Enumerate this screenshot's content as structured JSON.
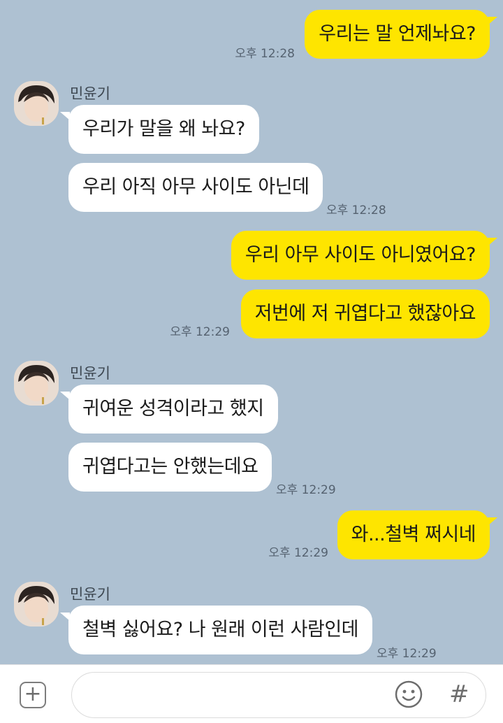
{
  "contact": {
    "name": "민윤기"
  },
  "messages": [
    {
      "side": "out",
      "text": "우리는 말 언제놔요?",
      "time": "오후 12:28"
    },
    {
      "side": "in",
      "sender": "민윤기",
      "text": "우리가 말을 왜 놔요?"
    },
    {
      "side": "in",
      "text": "우리 아직 아무 사이도 아닌데",
      "time": "오후 12:28"
    },
    {
      "side": "out",
      "text": "우리 아무 사이도 아니였어요?"
    },
    {
      "side": "out",
      "text": "저번에 저 귀엽다고 했잖아요",
      "time": "오후 12:29"
    },
    {
      "side": "in",
      "sender": "민윤기",
      "text": "귀여운 성격이라고 했지"
    },
    {
      "side": "in",
      "text": "귀엽다고는 안했는데요",
      "time": "오후 12:29"
    },
    {
      "side": "out",
      "text": "와...철벽 쩌시네",
      "time": "오후 12:29"
    },
    {
      "side": "in",
      "sender": "민윤기",
      "text": "철벽 싫어요? 나 원래 이런 사람인데",
      "time": "오후 12:29"
    }
  ],
  "composer": {
    "placeholder": "",
    "plus_icon": "plus-square-icon",
    "emoji_icon": "smiley-icon",
    "hash_icon": "hash-icon",
    "hash_glyph": "#",
    "plus_glyph": "+"
  },
  "colors": {
    "background": "#aec1d2",
    "outgoing_bubble": "#fee500",
    "incoming_bubble": "#ffffff"
  }
}
